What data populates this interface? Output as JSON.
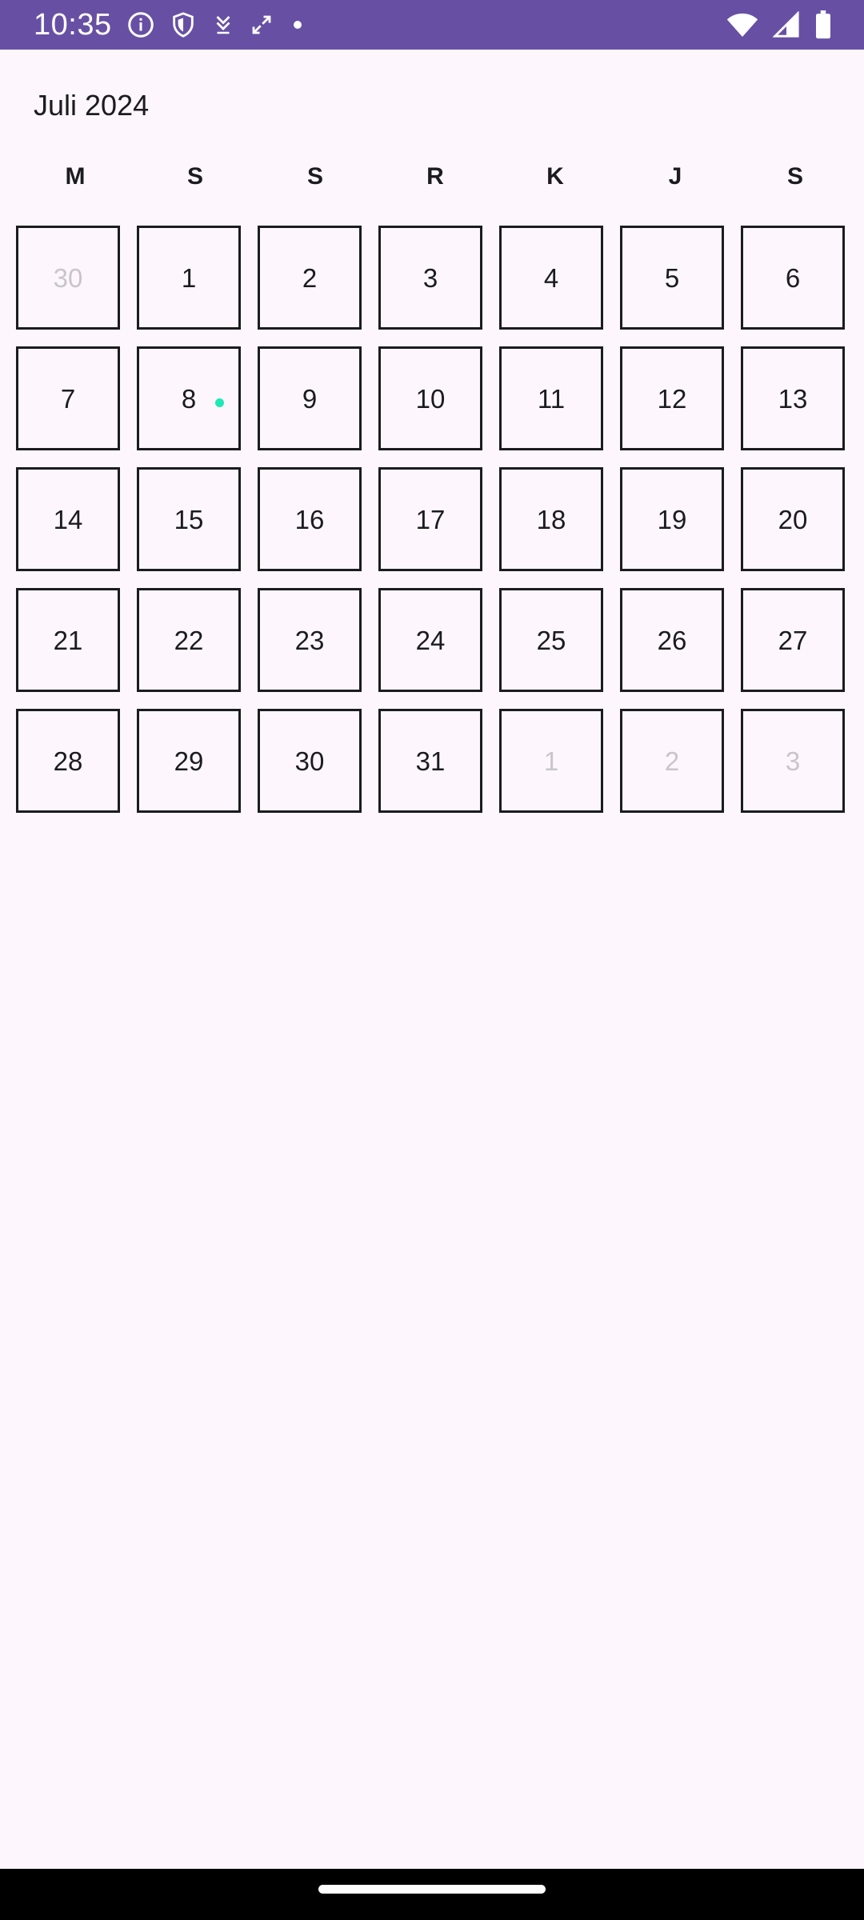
{
  "status_bar": {
    "time": "10:35",
    "left_icons": [
      "info-icon",
      "shield-icon",
      "download-arrow-icon",
      "sync-arrows-icon",
      "dot-icon"
    ],
    "right_icons": [
      "wifi-icon",
      "signal-icon",
      "battery-icon"
    ],
    "background": "#6750a4"
  },
  "calendar": {
    "month_title": "Juli 2024",
    "weekdays": [
      "M",
      "S",
      "S",
      "R",
      "K",
      "J",
      "S"
    ],
    "event_dot_color": "#1de9b6",
    "days": [
      {
        "label": "30",
        "outside": true
      },
      {
        "label": "1"
      },
      {
        "label": "2"
      },
      {
        "label": "3"
      },
      {
        "label": "4"
      },
      {
        "label": "5"
      },
      {
        "label": "6"
      },
      {
        "label": "7"
      },
      {
        "label": "8",
        "event": true
      },
      {
        "label": "9"
      },
      {
        "label": "10"
      },
      {
        "label": "11"
      },
      {
        "label": "12"
      },
      {
        "label": "13"
      },
      {
        "label": "14"
      },
      {
        "label": "15"
      },
      {
        "label": "16"
      },
      {
        "label": "17"
      },
      {
        "label": "18"
      },
      {
        "label": "19"
      },
      {
        "label": "20"
      },
      {
        "label": "21"
      },
      {
        "label": "22"
      },
      {
        "label": "23"
      },
      {
        "label": "24"
      },
      {
        "label": "25"
      },
      {
        "label": "26"
      },
      {
        "label": "27"
      },
      {
        "label": "28"
      },
      {
        "label": "29"
      },
      {
        "label": "30"
      },
      {
        "label": "31"
      },
      {
        "label": "1",
        "outside": true
      },
      {
        "label": "2",
        "outside": true
      },
      {
        "label": "3",
        "outside": true
      }
    ]
  }
}
